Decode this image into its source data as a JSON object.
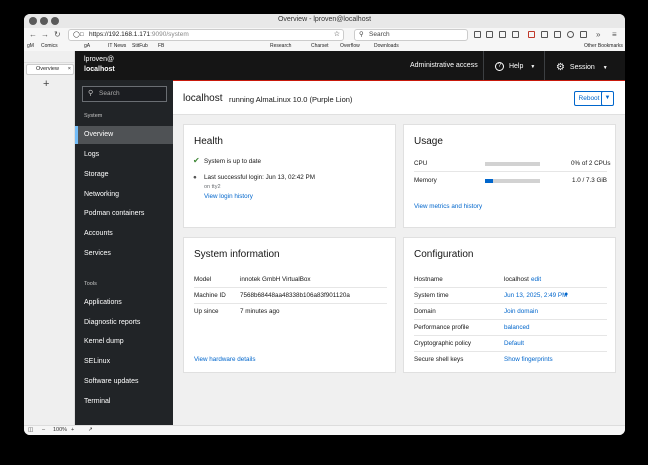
{
  "browser": {
    "window_title": "Overview - lproven@localhost",
    "url_host": "https://192.168.1.171",
    "url_path": ":9090/system",
    "search_placeholder": "Search",
    "bookmarks": [
      "gM",
      "Comics",
      "gA",
      "IT News",
      "StitFub",
      "FB",
      "Research",
      "Charset",
      "Overflow",
      "Downloads",
      "Other Bookmarks"
    ],
    "tab_label": "Overview",
    "zoom": "100%"
  },
  "cockpit": {
    "user": "lproven@",
    "host": "localhost",
    "search_placeholder": "Search",
    "sections": {
      "system": "System",
      "tools": "Tools"
    },
    "nav_system": [
      "Overview",
      "Logs",
      "Storage",
      "Networking",
      "Podman containers",
      "Accounts",
      "Services"
    ],
    "nav_tools": [
      "Applications",
      "Diagnostic reports",
      "Kernel dump",
      "SELinux",
      "Software updates",
      "Terminal"
    ],
    "topbar": {
      "admin": "Administrative access",
      "help": "Help",
      "session": "Session"
    },
    "header": {
      "hostname": "localhost",
      "os": "running AlmaLinux 10.0 (Purple Lion)",
      "reboot": "Reboot"
    },
    "health": {
      "title": "Health",
      "status": "System is up to date",
      "login": "Last successful login: Jun 13, 02:42 PM",
      "login_on": "on tty2",
      "login_link": "View login history"
    },
    "usage": {
      "title": "Usage",
      "cpu_label": "CPU",
      "cpu_value": "0% of 2 CPUs",
      "cpu_fraction": 0.0,
      "mem_label": "Memory",
      "mem_value": "1.0 / 7.3 GiB",
      "mem_fraction": 0.137,
      "link": "View metrics and history"
    },
    "sysinfo": {
      "title": "System information",
      "rows": [
        {
          "label": "Model",
          "value": "innotek GmbH VirtualBox"
        },
        {
          "label": "Machine ID",
          "value": "7568b68448aa48338b106a83f901120a"
        },
        {
          "label": "Up since",
          "value": "7 minutes ago"
        }
      ],
      "link": "View hardware details"
    },
    "config": {
      "title": "Configuration",
      "rows": [
        {
          "label": "Hostname",
          "value": "localhost",
          "extra": "edit"
        },
        {
          "label": "System time",
          "value": "Jun 13, 2025, 2:49 PM"
        },
        {
          "label": "Domain",
          "value": "Join domain"
        },
        {
          "label": "Performance profile",
          "value": "balanced"
        },
        {
          "label": "Cryptographic policy",
          "value": "Default"
        },
        {
          "label": "Secure shell keys",
          "value": "Show fingerprints"
        }
      ]
    }
  },
  "colors": {
    "sidebar_bg": "#212427",
    "topbar_bg": "#151515",
    "accent": "#0066cc",
    "active_marker": "#73bcf7",
    "ok_green": "#3e8635"
  }
}
